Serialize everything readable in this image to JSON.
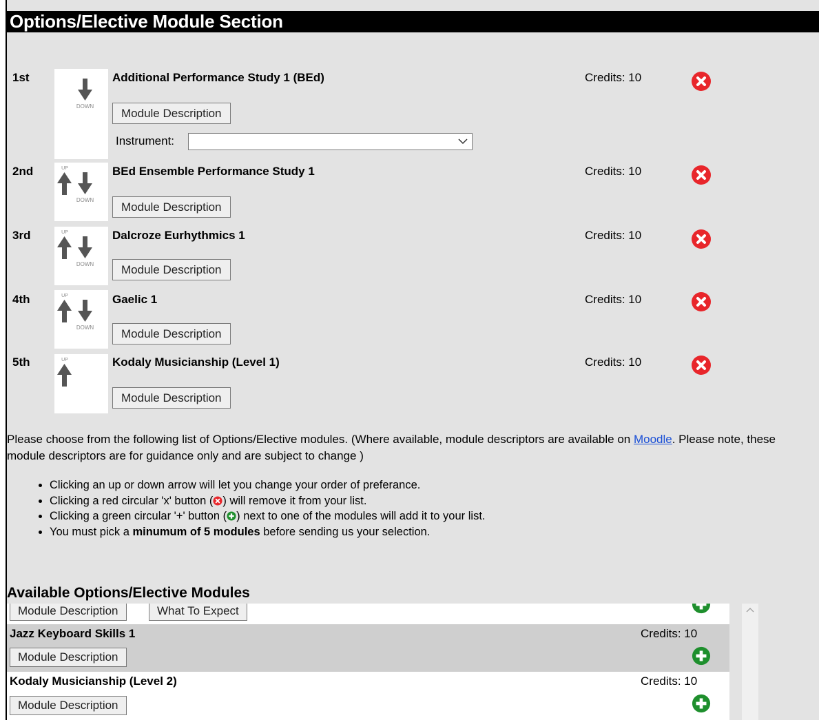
{
  "section_title": "Options/Elective Module Section",
  "selected_modules": [
    {
      "rank": "1st",
      "name": "Additional Performance Study 1 (BEd)",
      "credits": "Credits: 10",
      "button": "Module Description",
      "has_up": false,
      "has_down": true
    },
    {
      "rank": "2nd",
      "name": "BEd Ensemble Performance Study 1",
      "credits": "Credits: 10",
      "button": "Module Description",
      "has_up": true,
      "has_down": true
    },
    {
      "rank": "3rd",
      "name": "Dalcroze Eurhythmics 1",
      "credits": "Credits: 10",
      "button": "Module Description",
      "has_up": true,
      "has_down": true
    },
    {
      "rank": "4th",
      "name": "Gaelic 1",
      "credits": "Credits: 10",
      "button": "Module Description",
      "has_up": true,
      "has_down": true
    },
    {
      "rank": "5th",
      "name": "Kodaly Musicianship (Level 1)",
      "credits": "Credits: 10",
      "button": "Module Description",
      "has_up": true,
      "has_down": false
    }
  ],
  "arrow_labels": {
    "up": "UP",
    "down": "DOWN"
  },
  "instrument": {
    "label": "Instrument:",
    "value": ""
  },
  "intro": {
    "part1": "Please choose from the following list of Options/Elective modules. (Where available, module descriptors are available on ",
    "link": "Moodle",
    "part2": ". Please note, these module descriptors are for guidance only and are subject to change )"
  },
  "instructions": {
    "b1": "Clicking an up or down arrow will let you change your order of preferance.",
    "b2a": "Clicking a red circular 'x' button (",
    "b2b": ") will remove it from your list.",
    "b3a": "Clicking a green circular '+' button (",
    "b3b": ") next to one of the modules will add it to your list.",
    "b4a": "You must pick a ",
    "b4bold": "minumum of 5 modules",
    "b4b": " before sending us your selection."
  },
  "available_title": "Available Options/Elective Modules",
  "available_partial": {
    "button1": "Module Description",
    "button2": "What To Expect"
  },
  "available_modules": [
    {
      "name": "Jazz Keyboard Skills 1",
      "credits": "Credits: 10",
      "button": "Module Description"
    },
    {
      "name": "Kodaly Musicianship (Level 2)",
      "credits": "Credits: 10",
      "button": "Module Description"
    }
  ],
  "colors": {
    "remove": "#e8262b",
    "add": "#1e8f2d",
    "title_bar": "#000000",
    "panel": "#e3e3e3",
    "row_alt": "#cfcfcf"
  }
}
